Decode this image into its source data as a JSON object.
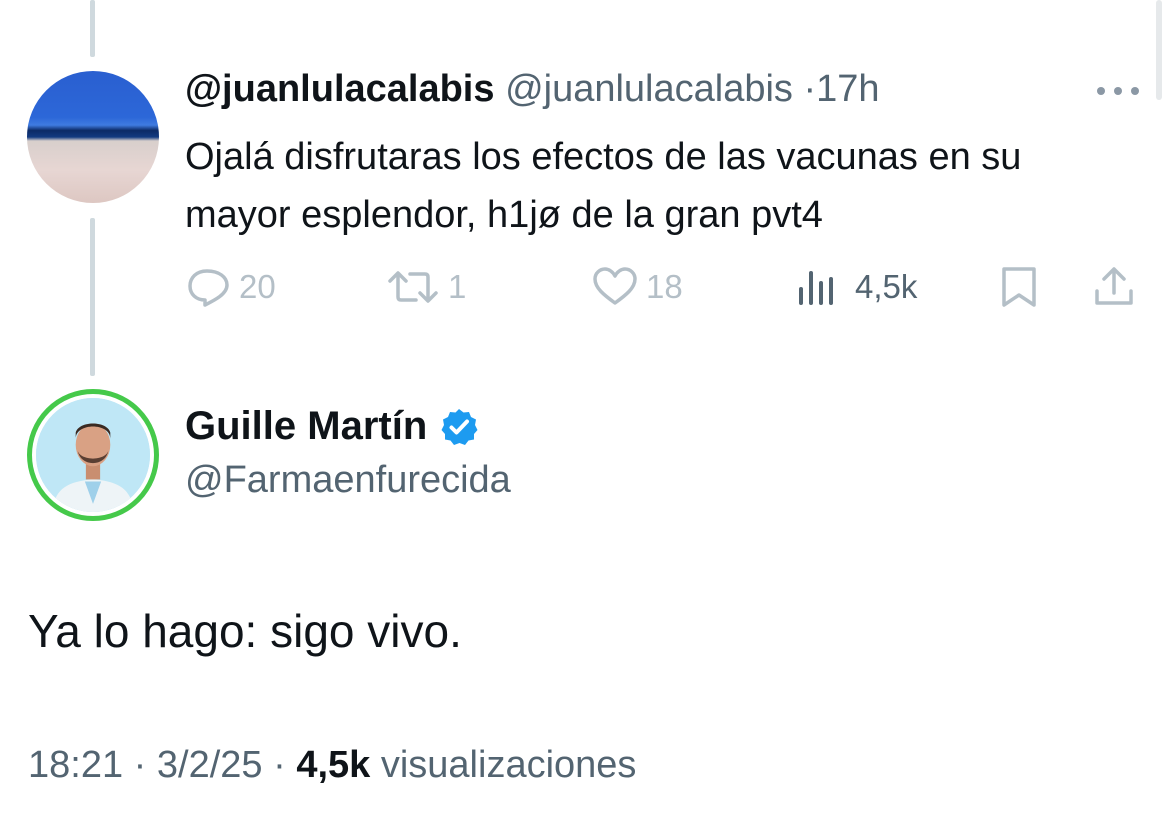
{
  "reply": {
    "display_name": "@juanlulacalabis",
    "handle": "@juanlulacalabis",
    "separator": "·",
    "time": "17h",
    "text": "Ojalá disfrutaras los efectos de las vacunas en su mayor esplendor, h1jø de la gran pvt4",
    "actions": {
      "replies": "20",
      "retweets": "1",
      "likes": "18",
      "views": "4,5k"
    },
    "icons": [
      "more-icon",
      "reply-icon",
      "retweet-icon",
      "like-icon",
      "views-icon",
      "bookmark-icon",
      "share-icon"
    ]
  },
  "tweet": {
    "display_name": "Guille Martín",
    "handle": "@Farmaenfurecida",
    "verified_color": "#1d9bf0",
    "text": "Ya lo hago: sigo vivo.",
    "time": "18:21",
    "date": "3/2/25",
    "separator": "·",
    "views_count": "4,5k",
    "views_label": "visualizaciones"
  },
  "colors": {
    "text": "#0f1419",
    "muted": "#536471",
    "faded_icon": "#b4bfc7",
    "thread_line": "#cfd9de",
    "avatar_ring": "#45c94a"
  }
}
